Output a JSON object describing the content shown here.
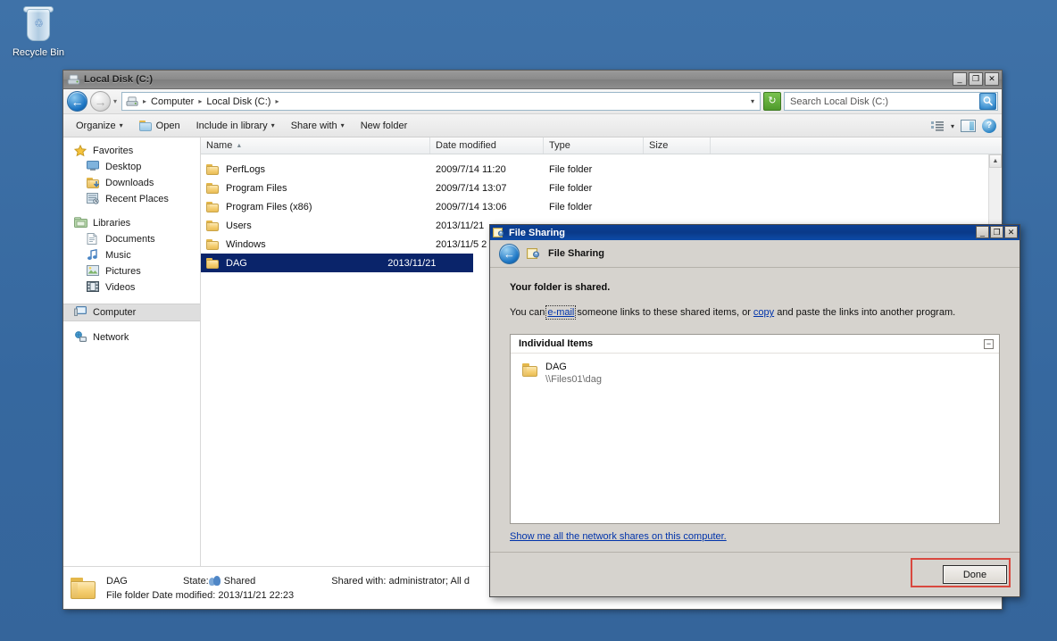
{
  "desktop": {
    "recycle_bin_label": "Recycle Bin"
  },
  "explorer": {
    "title": "Local Disk (C:)",
    "window_buttons": {
      "minimize": "_",
      "maximize": "❐",
      "close": "✕"
    },
    "address": {
      "crumbs": [
        "Computer",
        "Local Disk (C:)"
      ],
      "separator": "▸",
      "dropdown_caret": "▾",
      "refresh_label": "↻"
    },
    "search": {
      "value": "Search Local Disk (C:)",
      "placeholder": "Search Local Disk (C:)",
      "button_label": "🔍"
    },
    "toolbar": {
      "organize": "Organize",
      "open": "Open",
      "include_in_library": "Include in library",
      "share_with": "Share with",
      "new_folder": "New folder",
      "caret": "▾"
    },
    "nav_pane": {
      "groups": [
        {
          "header": {
            "label": "Favorites",
            "icon": "star-icon"
          },
          "items": [
            {
              "label": "Desktop",
              "icon": "desktop-icon"
            },
            {
              "label": "Downloads",
              "icon": "downloads-icon"
            },
            {
              "label": "Recent Places",
              "icon": "recent-places-icon"
            }
          ]
        },
        {
          "header": {
            "label": "Libraries",
            "icon": "libraries-icon"
          },
          "items": [
            {
              "label": "Documents",
              "icon": "document-icon"
            },
            {
              "label": "Music",
              "icon": "music-icon"
            },
            {
              "label": "Pictures",
              "icon": "picture-icon"
            },
            {
              "label": "Videos",
              "icon": "video-icon"
            }
          ]
        },
        {
          "header": {
            "label": "Computer",
            "icon": "computer-icon",
            "selected": true
          },
          "items": []
        },
        {
          "header": {
            "label": "Network",
            "icon": "network-icon"
          },
          "items": []
        }
      ]
    },
    "file_list": {
      "columns": [
        "Name",
        "Date modified",
        "Type",
        "Size"
      ],
      "sort_column": "Name",
      "sort_marker": "▲",
      "rows": [
        {
          "name": "PerfLogs",
          "date": "2009/7/14 11:20",
          "type": "File folder",
          "size": "",
          "selected": false
        },
        {
          "name": "Program Files",
          "date": "2009/7/14 13:07",
          "type": "File folder",
          "size": "",
          "selected": false
        },
        {
          "name": "Program Files (x86)",
          "date": "2009/7/14 13:06",
          "type": "File folder",
          "size": "",
          "selected": false
        },
        {
          "name": "Users",
          "date": "2013/11/21",
          "type": "",
          "size": "",
          "selected": false
        },
        {
          "name": "Windows",
          "date": "2013/11/5 2",
          "type": "",
          "size": "",
          "selected": false
        },
        {
          "name": "DAG",
          "date": "2013/11/21",
          "type": "",
          "size": "",
          "selected": true
        }
      ]
    },
    "status_bar": {
      "name": "DAG",
      "state_label": "State:",
      "state_value": "Shared",
      "shared_with_label": "Shared with:",
      "shared_with_value": "administrator; All d",
      "type_line": "File folder Date modified: 2013/11/21 22:23"
    }
  },
  "file_sharing_dialog": {
    "title": "File Sharing",
    "window_buttons": {
      "minimize": "_",
      "maximize": "❐",
      "close": "✕"
    },
    "header_title": "File Sharing",
    "back_label": "←",
    "heading": "Your folder is shared.",
    "body_prefix": "You can ",
    "body_link_email": "e-mail",
    "body_middle": " someone links to these shared items, or ",
    "body_link_copy": "copy",
    "body_suffix": " and paste the links into another program.",
    "group": {
      "title": "Individual Items",
      "collapse_glyph": "−",
      "items": [
        {
          "name": "DAG",
          "path": "\\\\Files01\\dag"
        }
      ]
    },
    "footer_link": "Show me all the network shares on this computer.",
    "done_button": {
      "prefix": "",
      "accel": "D",
      "rest": "one"
    },
    "done_button_label": "Done",
    "highlight_color": "#d9483f"
  }
}
